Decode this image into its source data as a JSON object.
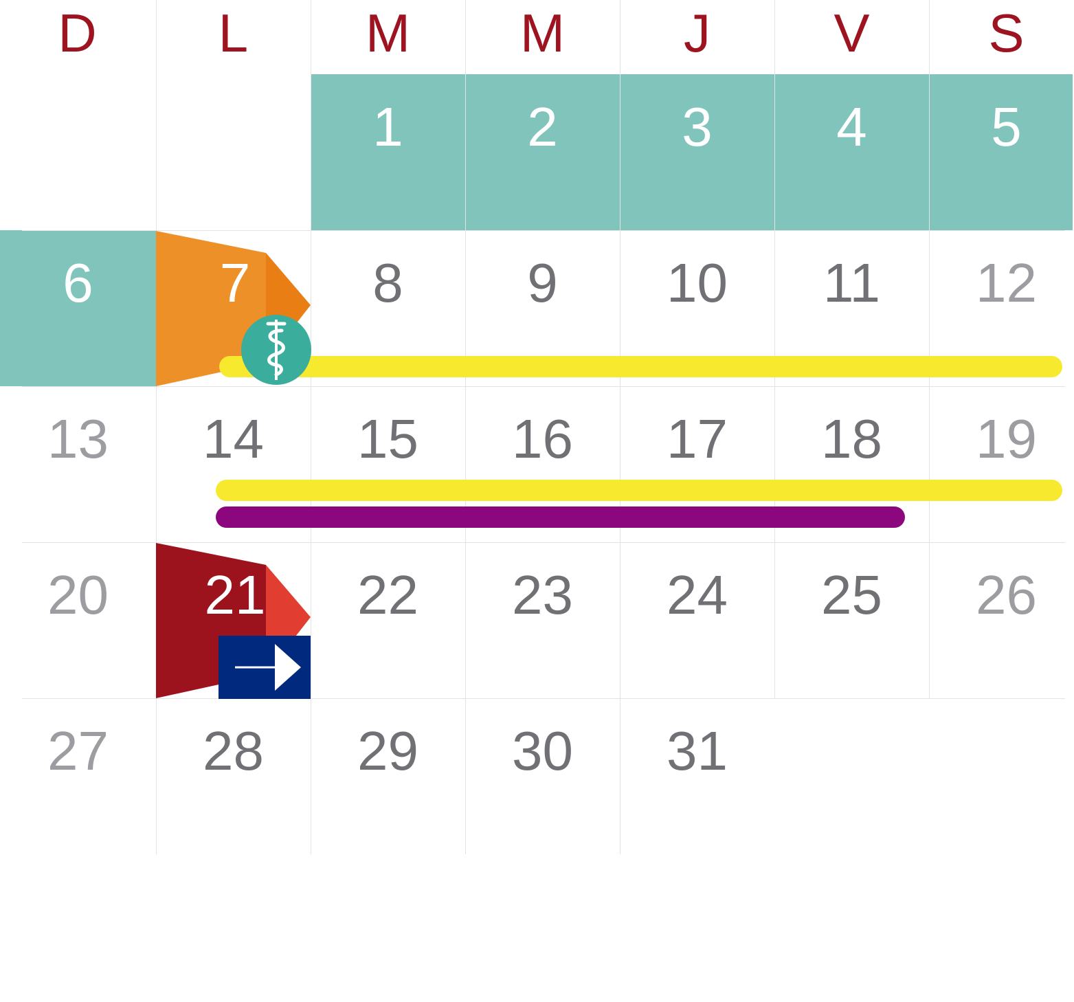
{
  "weekdays": [
    "D",
    "L",
    "M",
    "M",
    "J",
    "V",
    "S"
  ],
  "weeks": [
    [
      null,
      null,
      1,
      2,
      3,
      4,
      5
    ],
    [
      6,
      7,
      8,
      9,
      10,
      11,
      12
    ],
    [
      13,
      14,
      15,
      16,
      17,
      18,
      19
    ],
    [
      20,
      21,
      22,
      23,
      24,
      25,
      26
    ],
    [
      27,
      28,
      29,
      30,
      31,
      null,
      null
    ]
  ],
  "highlighted_days": [
    1,
    2,
    3,
    4,
    5,
    6
  ],
  "markers": [
    {
      "day": 7,
      "type": "orange-flag",
      "icon": "medical-caduceus-icon"
    },
    {
      "day": 21,
      "type": "red-flag",
      "icon": "arrow-right-icon"
    }
  ],
  "bars": [
    {
      "from_day": 7,
      "to_day": 12,
      "color": "#f7ea2e"
    },
    {
      "from_day": 14,
      "to_day": 19,
      "color": "#f7ea2e"
    },
    {
      "from_day": 14,
      "to_day": 18,
      "color": "#8c067e"
    }
  ],
  "colors": {
    "weekday_text": "#9d1420",
    "highlight_bg": "#80c4bb",
    "weekday_num": "#707075",
    "weekend_num": "#9c9ca1",
    "highlight_num": "#ffffff",
    "orange_flag": "#ee9028",
    "orange_flag_tip": "#e97f14",
    "red_flag": "#9c131d",
    "red_flag_tip": "#e23d31",
    "caduceus_circle": "#3aad9c",
    "arrow_box": "#012a7e"
  }
}
